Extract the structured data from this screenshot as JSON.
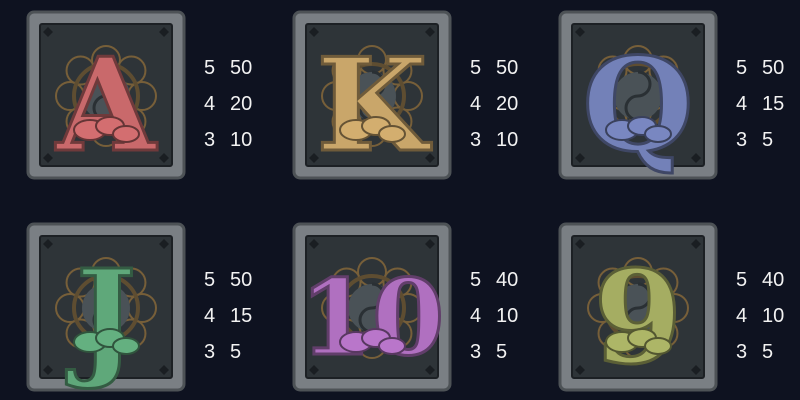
{
  "symbols": [
    {
      "id": "A",
      "glyph": "A",
      "color": "#c9696b",
      "pays": [
        {
          "count": "5",
          "value": "50"
        },
        {
          "count": "4",
          "value": "20"
        },
        {
          "count": "3",
          "value": "10"
        }
      ]
    },
    {
      "id": "K",
      "glyph": "K",
      "color": "#c9a66a",
      "pays": [
        {
          "count": "5",
          "value": "50"
        },
        {
          "count": "4",
          "value": "20"
        },
        {
          "count": "3",
          "value": "10"
        }
      ]
    },
    {
      "id": "Q",
      "glyph": "Q",
      "color": "#7381b8",
      "pays": [
        {
          "count": "5",
          "value": "50"
        },
        {
          "count": "4",
          "value": "15"
        },
        {
          "count": "3",
          "value": "5"
        }
      ]
    },
    {
      "id": "J",
      "glyph": "J",
      "color": "#5fa87a",
      "pays": [
        {
          "count": "5",
          "value": "50"
        },
        {
          "count": "4",
          "value": "15"
        },
        {
          "count": "3",
          "value": "5"
        }
      ]
    },
    {
      "id": "10",
      "glyph": "10",
      "color": "#b070c0",
      "pays": [
        {
          "count": "5",
          "value": "40"
        },
        {
          "count": "4",
          "value": "10"
        },
        {
          "count": "3",
          "value": "5"
        }
      ]
    },
    {
      "id": "9",
      "glyph": "9",
      "color": "#a5ad62",
      "pays": [
        {
          "count": "5",
          "value": "40"
        },
        {
          "count": "4",
          "value": "10"
        },
        {
          "count": "3",
          "value": "5"
        }
      ]
    }
  ],
  "colors": {
    "background": "#0e1220",
    "tile_frame": "#7a7f84",
    "tile_inner": "#2e3438",
    "mandala": "#8a6a3a",
    "text": "#f2f2f2"
  }
}
